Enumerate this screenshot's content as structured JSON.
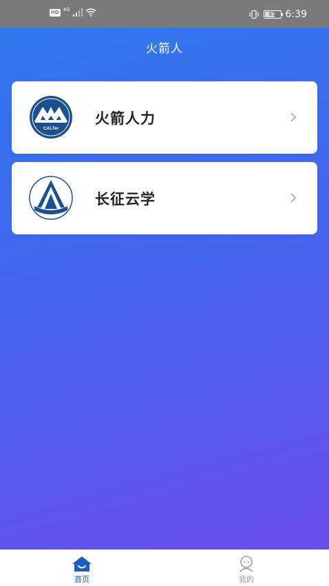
{
  "status_bar": {
    "hd": "HD",
    "network": "4G",
    "battery": "65",
    "time": "6:39"
  },
  "header": {
    "title": "火箭人"
  },
  "cards": [
    {
      "label": "火箭人力",
      "logo_text": "CALTer",
      "logo_icon": "caltech-logo-icon"
    },
    {
      "label": "长征云学",
      "logo_icon": "changzheng-logo-icon"
    }
  ],
  "tab_bar": {
    "home_label": "首页",
    "mine_label": "我的"
  },
  "colors": {
    "gradient_start": "#2f78ee",
    "gradient_end": "#6a4eee",
    "brand_blue": "#1e5cc4",
    "logo_navy": "#1b4f8f"
  }
}
